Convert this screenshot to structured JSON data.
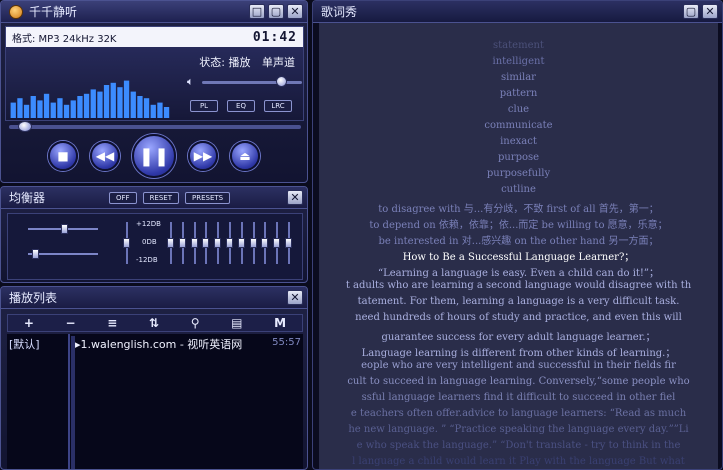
{
  "player": {
    "title": "千千静听",
    "format": "格式: MP3 24kHz 32K",
    "time": "01:42",
    "status_label": "状态: 播放",
    "channel": "单声道",
    "btn_pl": "PL",
    "btn_eq": "EQ",
    "btn_lrc": "LRC",
    "spectrum": [
      0.35,
      0.45,
      0.3,
      0.5,
      0.4,
      0.55,
      0.35,
      0.45,
      0.3,
      0.4,
      0.5,
      0.55,
      0.65,
      0.6,
      0.75,
      0.8,
      0.7,
      0.85,
      0.6,
      0.5,
      0.45,
      0.3,
      0.35,
      0.25
    ],
    "seek_fraction": 0.05,
    "volume_fraction": 0.8,
    "controls": [
      "stop",
      "prev",
      "pause",
      "next",
      "eject"
    ],
    "win_buttons": [
      "□",
      "▢",
      "✕"
    ]
  },
  "equalizer": {
    "title": "均衡器",
    "off": "OFF",
    "reset": "RESET",
    "presets": "PRESETS",
    "label_top": "+12DB",
    "label_mid": "0DB",
    "label_bottom": "-12DB",
    "band_levels": [
      0.5,
      0.5,
      0.5,
      0.5,
      0.5,
      0.5,
      0.5,
      0.5,
      0.5,
      0.5,
      0.5
    ]
  },
  "playlist": {
    "title": "播放列表",
    "tools": [
      "+",
      "−",
      "≡",
      "⇅",
      "⚲",
      "▤",
      "M"
    ],
    "group": "[默认]",
    "item": "1.walenglish.com - 视听英语网",
    "duration": "55:57"
  },
  "lyrics": {
    "title": "歌词秀",
    "lines": [
      {
        "text": "statement",
        "color": "#4b5079"
      },
      {
        "text": "intelligent",
        "color": "#6a70a8"
      },
      {
        "text": "similar",
        "color": "#7a80b8"
      },
      {
        "text": "pattern",
        "color": "#7a80b8"
      },
      {
        "text": "clue",
        "color": "#7a80b8"
      },
      {
        "text": "communicate",
        "color": "#7a80b8"
      },
      {
        "text": "inexact",
        "color": "#7a80b8"
      },
      {
        "text": "purpose",
        "color": "#7a80b8"
      },
      {
        "text": "purposefully",
        "color": "#7a80b8"
      },
      {
        "text": "cutline",
        "color": "#7a80b8"
      },
      {
        "text": "to disagree with 与...有分歧，不致 first of all 首先，第一；",
        "color": "#7a80b8"
      },
      {
        "text": "to depend on 依赖，依靠；依...而定 be willing to 愿意，乐意；",
        "color": "#7a80b8"
      },
      {
        "text": "be interested in 对...感兴趣 on the other hand 另一方面；",
        "color": "#7a80b8"
      },
      {
        "text": "How to Be a Successful Language Learner?；",
        "color": "#ffffff"
      },
      {
        "text": "“Learning a language is easy. Even a child can do it!”；",
        "color": "#aab0e0"
      },
      {
        "text": "t adults who are learning a second language would disagree with th",
        "color": "#aab0e0"
      },
      {
        "text": "tatement. For them, learning a language is a very difficult task.",
        "color": "#aab0e0"
      },
      {
        "text": "need hundreds of hours of study and practice, and even this will",
        "color": "#aab0e0"
      },
      {
        "text": "guarantee success for every adult language learner.；",
        "color": "#aab0e0"
      },
      {
        "text": "Language learning is different from other kinds of learning.；",
        "color": "#aab0e0"
      },
      {
        "text": "eople who are very intelligent and successful in their fields fir",
        "color": "#9aa0d2"
      },
      {
        "text": "cult to succeed in language learning. Conversely,“some people who",
        "color": "#8a90c2"
      },
      {
        "text": "ssful language learners find it difficult to succeed in other fiel",
        "color": "#7a80b2"
      },
      {
        "text": "e teachers often offer.advice to language learners: “Read as much",
        "color": "#6a70a2"
      },
      {
        "text": "he new language. ” “Practice speaking the language every day.””Li",
        "color": "#5a6092"
      },
      {
        "text": "e who speak the language.” “Don't translate - try to think in the",
        "color": "#4a5082"
      },
      {
        "text": "l language a child would learn it  Play with the language But what",
        "color": "#3a4072"
      }
    ]
  }
}
